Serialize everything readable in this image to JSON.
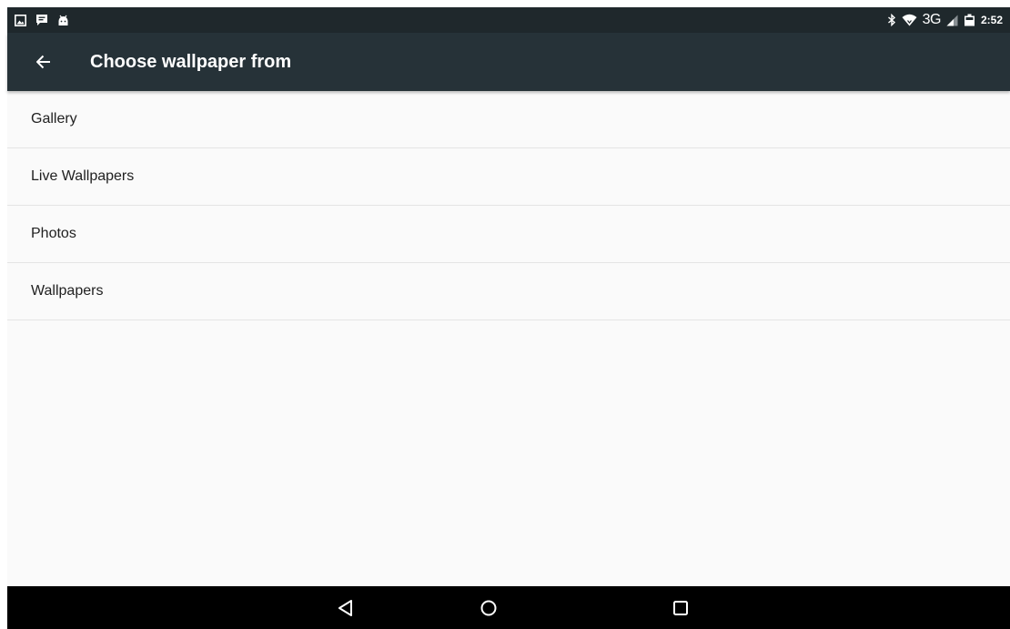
{
  "status_bar": {
    "notification_icons": [
      "gallery-icon",
      "message-icon",
      "android-icon"
    ],
    "system_icons": [
      "bluetooth-icon",
      "wifi-icon",
      "signal-icon",
      "battery-icon"
    ],
    "network_type": "3G",
    "time": "2:52"
  },
  "toolbar": {
    "title": "Choose wallpaper from",
    "back_icon": "arrow-back-icon"
  },
  "list": {
    "items": [
      {
        "label": "Gallery"
      },
      {
        "label": "Live Wallpapers"
      },
      {
        "label": "Photos"
      },
      {
        "label": "Wallpapers"
      }
    ]
  },
  "nav_bar": {
    "buttons": [
      "back-triangle-icon",
      "home-circle-icon",
      "recents-square-icon"
    ]
  },
  "colors": {
    "status_bar": "#1f282c",
    "toolbar": "#263238",
    "list_background": "#fafafa",
    "divider": "#e4e4e4",
    "nav_bar": "#000000"
  }
}
